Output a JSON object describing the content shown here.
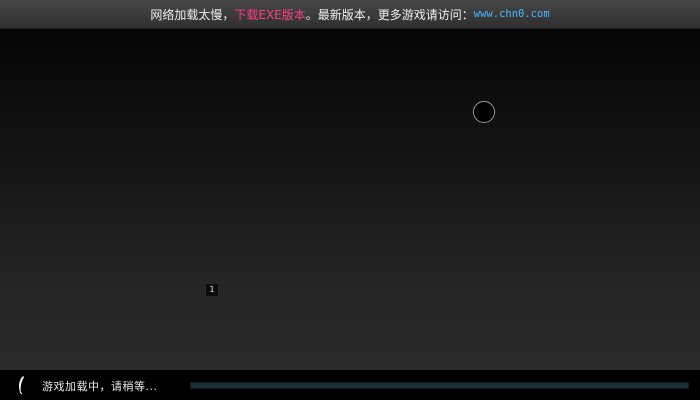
{
  "notice": {
    "part1": "网络加载太慢，",
    "download_link": "下载EXE版本",
    "part2": "。最新版本，更多游戏请访问：",
    "site_url": "www.chn0.com"
  },
  "game": {
    "level_marker": "1"
  },
  "loader": {
    "text": "游戏加载中，请稍等...",
    "progress": 0
  },
  "colors": {
    "link_pink": "#ff3d86",
    "url_blue": "#4ab8ff",
    "progress_track": "#1d3138"
  },
  "icons": {
    "loader": "feather-quill-icon"
  }
}
